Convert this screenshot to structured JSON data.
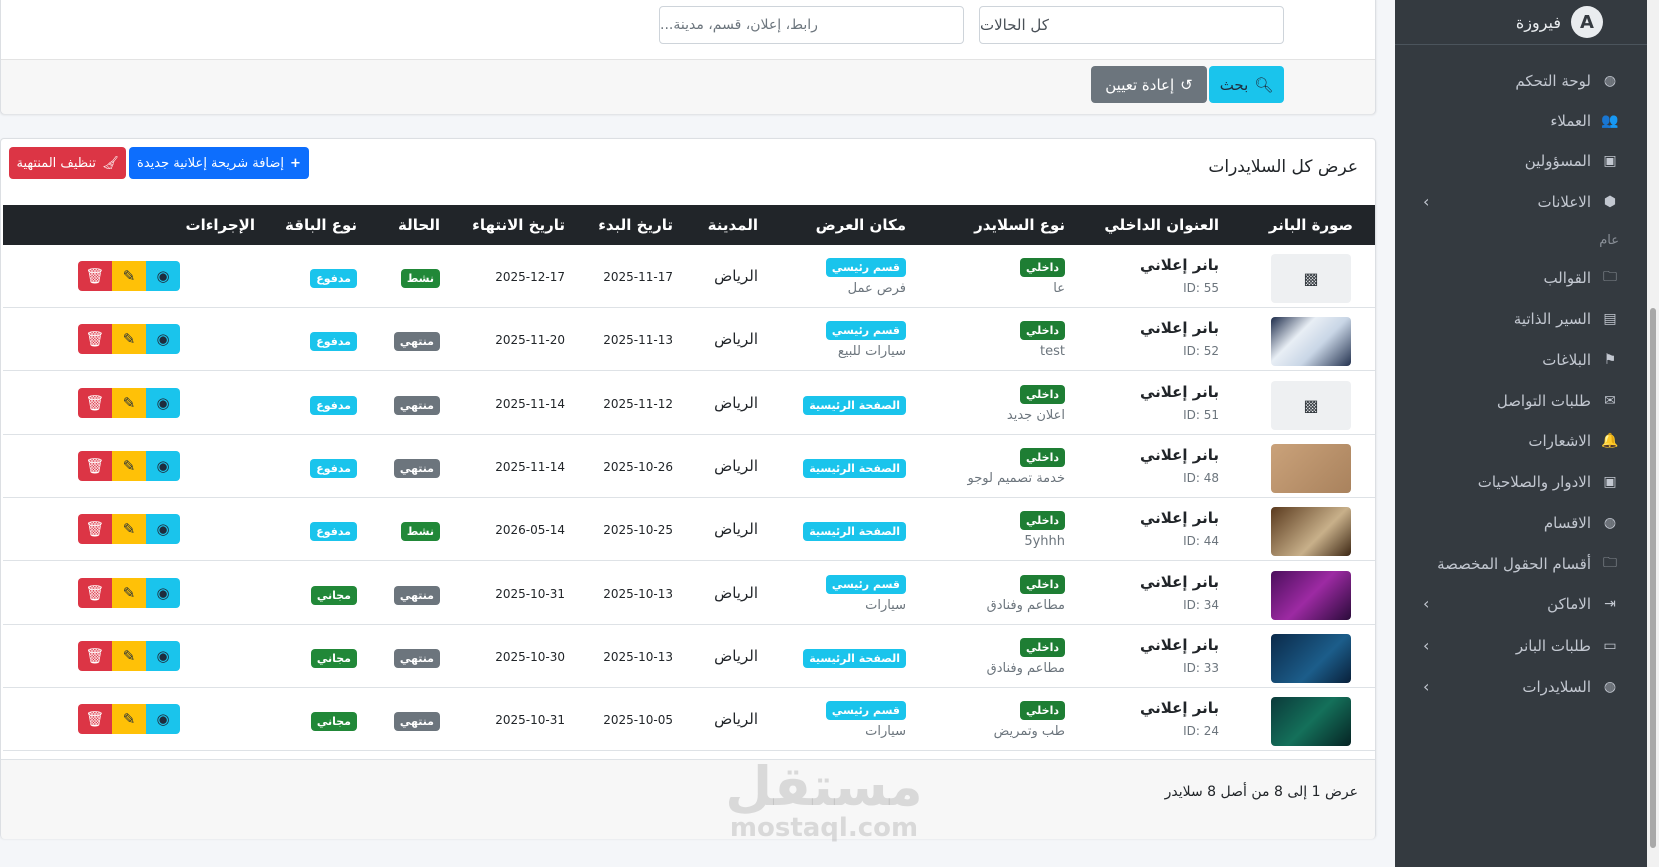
{
  "sidebar": {
    "brand": "فيروزة",
    "items": [
      {
        "label": "لوحة التحكم",
        "icon": "palette-icon",
        "glyph": "◍",
        "chevron": false
      },
      {
        "label": "العملاء",
        "icon": "users-icon",
        "glyph": "👥",
        "chevron": false
      },
      {
        "label": "المسؤولين",
        "icon": "id-card-icon",
        "glyph": "▣",
        "chevron": false
      },
      {
        "label": "الاعلانات",
        "icon": "box-icon",
        "glyph": "⬢",
        "chevron": true
      },
      {
        "label": "القوالب",
        "icon": "folder-icon",
        "glyph": "🗀",
        "chevron": false
      },
      {
        "label": "السير الذاتية",
        "icon": "file-user-icon",
        "glyph": "▤",
        "chevron": false
      },
      {
        "label": "البلاغات",
        "icon": "flag-icon",
        "glyph": "⚑",
        "chevron": false
      },
      {
        "label": "طلبات التواصل",
        "icon": "envelope-icon",
        "glyph": "✉",
        "chevron": false
      },
      {
        "label": "الاشعارات",
        "icon": "bell-icon",
        "glyph": "🔔",
        "chevron": false
      },
      {
        "label": "الادوار والصلاحيات",
        "icon": "id-badge-icon",
        "glyph": "▣",
        "chevron": false
      },
      {
        "label": "الاقسام",
        "icon": "palette-icon",
        "glyph": "◍",
        "chevron": false
      },
      {
        "label": "أقسام الحقول المخصصة",
        "icon": "folder-plus-icon",
        "glyph": "🗀",
        "chevron": false
      },
      {
        "label": "الاماكن",
        "icon": "sign-in-icon",
        "glyph": "⇥",
        "chevron": true
      },
      {
        "label": "طلبات البانر",
        "icon": "ad-icon",
        "glyph": "▭",
        "chevron": true
      },
      {
        "label": "السلايدرات",
        "icon": "palette-icon",
        "glyph": "◍",
        "chevron": true
      }
    ],
    "section_header": "عام"
  },
  "filters": {
    "status_select": "كل الحالات",
    "search_placeholder": "رابط، إعلان، قسم، مدينة...",
    "search_button": "بحث",
    "reset_button": "إعادة تعيين"
  },
  "table_card": {
    "title": "عرض كل السلايدرات",
    "add_button": "إضافة شريحة إعلانية جديدة",
    "cleanup_button": "تنظيف المنتهية",
    "columns": [
      "صورة البانر",
      "العنوان الداخلي",
      "نوع السلايدر",
      "مكان العرض",
      "المدينة",
      "تاريخ البدء",
      "تاريخ الانتهاء",
      "الحالة",
      "نوع الباقة",
      "الإجراءات"
    ],
    "rows": [
      {
        "thumb": "placeholder",
        "title": "بانر إعلاني",
        "id": "ID: 55",
        "type": "داخلي",
        "sub": "عا",
        "place": "قسم رئيسي",
        "place_sub": "فرص عمل",
        "city": "الرياض",
        "start": "2025-11-17",
        "end": "2025-12-17",
        "status": "نشط",
        "package": "مدفوع"
      },
      {
        "thumb": "cards",
        "title": "بانر إعلاني",
        "id": "ID: 52",
        "type": "داخلي",
        "sub": "test",
        "place": "قسم رئيسي",
        "place_sub": "سيارات للبيع",
        "city": "الرياض",
        "start": "2025-11-13",
        "end": "2025-11-20",
        "status": "منتهي",
        "package": "مدفوع"
      },
      {
        "thumb": "placeholder",
        "title": "بانر إعلاني",
        "id": "ID: 51",
        "type": "داخلي",
        "sub": "اعلان جديد",
        "place": "الصفحة الرئيسية",
        "place_sub": "",
        "city": "الرياض",
        "start": "2025-11-12",
        "end": "2025-11-14",
        "status": "منتهي",
        "package": "مدفوع"
      },
      {
        "thumb": "wood",
        "title": "بانر إعلاني",
        "id": "ID: 48",
        "type": "داخلي",
        "sub": "خدمة تصميم لوجو",
        "place": "الصفحة الرئيسية",
        "place_sub": "",
        "city": "الرياض",
        "start": "2025-10-26",
        "end": "2025-11-14",
        "status": "منتهي",
        "package": "مدفوع"
      },
      {
        "thumb": "brown",
        "title": "بانر إعلاني",
        "id": "ID: 44",
        "type": "داخلي",
        "sub": "5yhhh",
        "place": "الصفحة الرئيسية",
        "place_sub": "",
        "city": "الرياض",
        "start": "2025-10-25",
        "end": "2026-05-14",
        "status": "نشط",
        "package": "مدفوع"
      },
      {
        "thumb": "purple",
        "title": "بانر إعلاني",
        "id": "ID: 34",
        "type": "داخلي",
        "sub": "مطاعم وفنادق",
        "place": "قسم رئيسي",
        "place_sub": "سيارات",
        "city": "الرياض",
        "start": "2025-10-13",
        "end": "2025-10-31",
        "status": "منتهي",
        "package": "مجاني"
      },
      {
        "thumb": "navy",
        "title": "بانر إعلاني",
        "id": "ID: 33",
        "type": "داخلي",
        "sub": "مطاعم وفنادق",
        "place": "الصفحة الرئيسية",
        "place_sub": "",
        "city": "الرياض",
        "start": "2025-10-13",
        "end": "2025-10-30",
        "status": "منتهي",
        "package": "مجاني"
      },
      {
        "thumb": "teal",
        "title": "بانر إعلاني",
        "id": "ID: 24",
        "type": "داخلي",
        "sub": "طب وتمريض",
        "place": "قسم رئيسي",
        "place_sub": "سيارات",
        "city": "الرياض",
        "start": "2025-10-05",
        "end": "2025-10-31",
        "status": "منتهي",
        "package": "مجاني"
      }
    ],
    "footer": "عرض 1 إلى 8 من أصل 8 سلايدر"
  },
  "watermark": {
    "ar": "مستقل",
    "en": "mostaql.com"
  },
  "colors": {
    "sidebar": "#343a40",
    "info": "#1ac4ec",
    "danger": "#dc3545",
    "warning": "#ffc107",
    "success": "#218838",
    "secondary": "#6c757d"
  }
}
